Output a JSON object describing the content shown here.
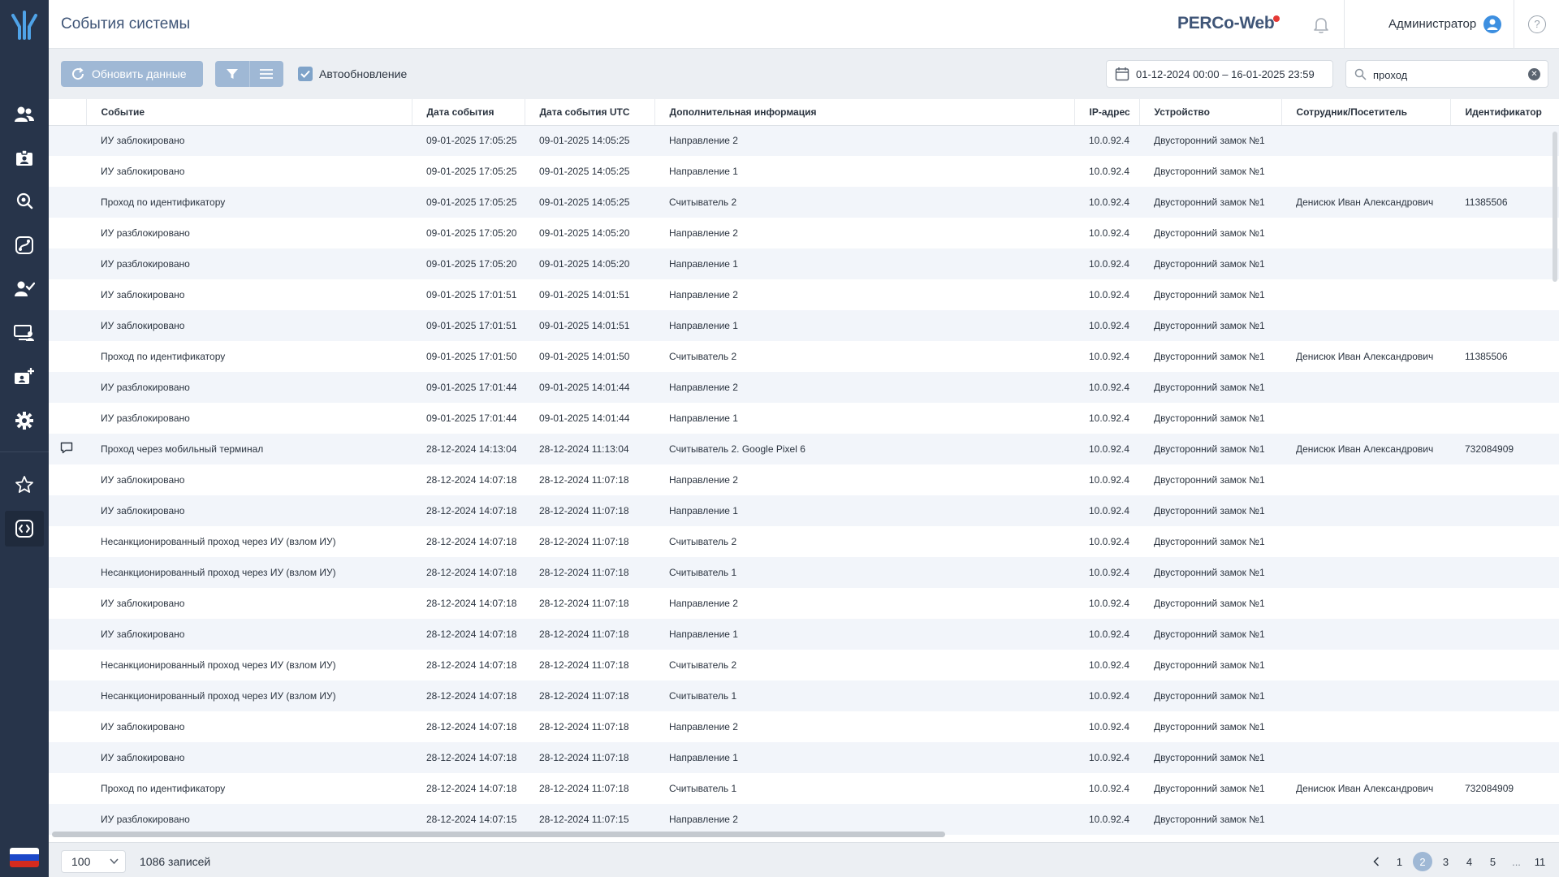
{
  "header": {
    "title": "События системы",
    "brand": "PERCo-Web",
    "user": "Администратор",
    "help": "?"
  },
  "toolbar": {
    "refresh_label": "Обновить данные",
    "auto_update_label": "Автообновление",
    "date_range": "01-12-2024 00:00 – 16-01-2025 23:59",
    "search_value": "проход"
  },
  "sidebar": {
    "items": [
      "users-icon",
      "id-card-icon",
      "location-search-icon",
      "route-icon",
      "user-check-icon",
      "monitor-user-icon",
      "id-card-add-icon",
      "gear-icon",
      "star-icon",
      "events-icon"
    ],
    "active": "events-icon"
  },
  "table": {
    "headers": [
      "",
      "Событие",
      "Дата события",
      "Дата события UTC",
      "Дополнительная информация",
      "IP-адрес",
      "Устройство",
      "Сотрудник/Посетитель",
      "Идентификатор"
    ],
    "rows": [
      [
        "",
        "ИУ заблокировано",
        "09-01-2025 17:05:25",
        "09-01-2025 14:05:25",
        "Направление 2",
        "10.0.92.4",
        "Двусторонний замок №1",
        "",
        ""
      ],
      [
        "",
        "ИУ заблокировано",
        "09-01-2025 17:05:25",
        "09-01-2025 14:05:25",
        "Направление 1",
        "10.0.92.4",
        "Двусторонний замок №1",
        "",
        ""
      ],
      [
        "",
        "Проход по идентификатору",
        "09-01-2025 17:05:25",
        "09-01-2025 14:05:25",
        "Считыватель 2",
        "10.0.92.4",
        "Двусторонний замок №1",
        "Денисюк Иван Александрович",
        "11385506"
      ],
      [
        "",
        "ИУ разблокировано",
        "09-01-2025 17:05:20",
        "09-01-2025 14:05:20",
        "Направление 2",
        "10.0.92.4",
        "Двусторонний замок №1",
        "",
        ""
      ],
      [
        "",
        "ИУ разблокировано",
        "09-01-2025 17:05:20",
        "09-01-2025 14:05:20",
        "Направление 1",
        "10.0.92.4",
        "Двусторонний замок №1",
        "",
        ""
      ],
      [
        "",
        "ИУ заблокировано",
        "09-01-2025 17:01:51",
        "09-01-2025 14:01:51",
        "Направление 2",
        "10.0.92.4",
        "Двусторонний замок №1",
        "",
        ""
      ],
      [
        "",
        "ИУ заблокировано",
        "09-01-2025 17:01:51",
        "09-01-2025 14:01:51",
        "Направление 1",
        "10.0.92.4",
        "Двусторонний замок №1",
        "",
        ""
      ],
      [
        "",
        "Проход по идентификатору",
        "09-01-2025 17:01:50",
        "09-01-2025 14:01:50",
        "Считыватель 2",
        "10.0.92.4",
        "Двусторонний замок №1",
        "Денисюк Иван Александрович",
        "11385506"
      ],
      [
        "",
        "ИУ разблокировано",
        "09-01-2025 17:01:44",
        "09-01-2025 14:01:44",
        "Направление 2",
        "10.0.92.4",
        "Двусторонний замок №1",
        "",
        ""
      ],
      [
        "",
        "ИУ разблокировано",
        "09-01-2025 17:01:44",
        "09-01-2025 14:01:44",
        "Направление 1",
        "10.0.92.4",
        "Двусторонний замок №1",
        "",
        ""
      ],
      [
        "comment-icon",
        "Проход через мобильный терминал",
        "28-12-2024 14:13:04",
        "28-12-2024 11:13:04",
        "Считыватель 2. Google Pixel 6",
        "10.0.92.4",
        "Двусторонний замок №1",
        "Денисюк Иван Александрович",
        "732084909"
      ],
      [
        "",
        "ИУ заблокировано",
        "28-12-2024 14:07:18",
        "28-12-2024 11:07:18",
        "Направление 2",
        "10.0.92.4",
        "Двусторонний замок №1",
        "",
        ""
      ],
      [
        "",
        "ИУ заблокировано",
        "28-12-2024 14:07:18",
        "28-12-2024 11:07:18",
        "Направление 1",
        "10.0.92.4",
        "Двусторонний замок №1",
        "",
        ""
      ],
      [
        "",
        "Несанкционированный проход через ИУ (взлом ИУ)",
        "28-12-2024 14:07:18",
        "28-12-2024 11:07:18",
        "Считыватель 2",
        "10.0.92.4",
        "Двусторонний замок №1",
        "",
        ""
      ],
      [
        "",
        "Несанкционированный проход через ИУ (взлом ИУ)",
        "28-12-2024 14:07:18",
        "28-12-2024 11:07:18",
        "Считыватель 1",
        "10.0.92.4",
        "Двусторонний замок №1",
        "",
        ""
      ],
      [
        "",
        "ИУ заблокировано",
        "28-12-2024 14:07:18",
        "28-12-2024 11:07:18",
        "Направление 2",
        "10.0.92.4",
        "Двусторонний замок №1",
        "",
        ""
      ],
      [
        "",
        "ИУ заблокировано",
        "28-12-2024 14:07:18",
        "28-12-2024 11:07:18",
        "Направление 1",
        "10.0.92.4",
        "Двусторонний замок №1",
        "",
        ""
      ],
      [
        "",
        "Несанкционированный проход через ИУ (взлом ИУ)",
        "28-12-2024 14:07:18",
        "28-12-2024 11:07:18",
        "Считыватель 2",
        "10.0.92.4",
        "Двусторонний замок №1",
        "",
        ""
      ],
      [
        "",
        "Несанкционированный проход через ИУ (взлом ИУ)",
        "28-12-2024 14:07:18",
        "28-12-2024 11:07:18",
        "Считыватель 1",
        "10.0.92.4",
        "Двусторонний замок №1",
        "",
        ""
      ],
      [
        "",
        "ИУ заблокировано",
        "28-12-2024 14:07:18",
        "28-12-2024 11:07:18",
        "Направление 2",
        "10.0.92.4",
        "Двусторонний замок №1",
        "",
        ""
      ],
      [
        "",
        "ИУ заблокировано",
        "28-12-2024 14:07:18",
        "28-12-2024 11:07:18",
        "Направление 1",
        "10.0.92.4",
        "Двусторонний замок №1",
        "",
        ""
      ],
      [
        "",
        "Проход по идентификатору",
        "28-12-2024 14:07:18",
        "28-12-2024 11:07:18",
        "Считыватель 1",
        "10.0.92.4",
        "Двусторонний замок №1",
        "Денисюк Иван Александрович",
        "732084909"
      ],
      [
        "",
        "ИУ разблокировано",
        "28-12-2024 14:07:15",
        "28-12-2024 11:07:15",
        "Направление 2",
        "10.0.92.4",
        "Двусторонний замок №1",
        "",
        ""
      ]
    ]
  },
  "footer": {
    "page_size": "100",
    "records": "1086 записей",
    "pages": [
      "1",
      "2",
      "3",
      "4",
      "5",
      "...",
      "11"
    ],
    "current_page": "2"
  },
  "colors": {
    "sidebar": "#27344a",
    "accent": "#9fb8d5",
    "brand_dot": "#e53935",
    "row_striped": "#f2f5fa"
  }
}
